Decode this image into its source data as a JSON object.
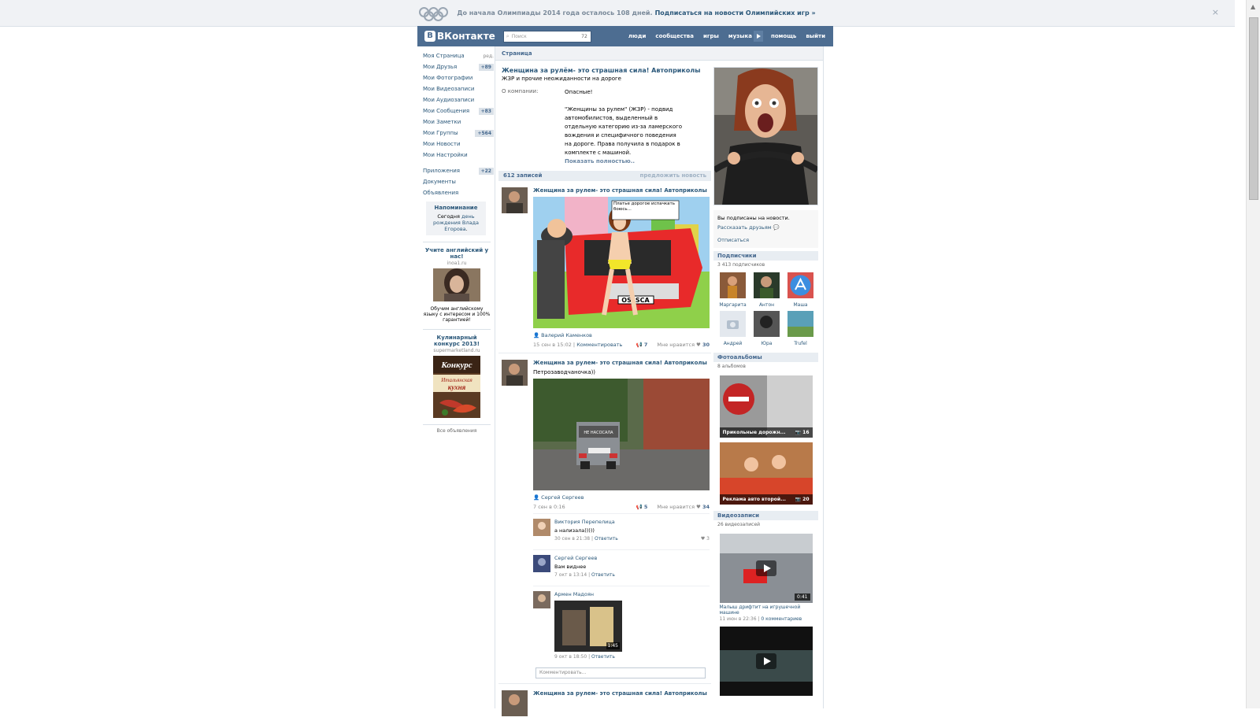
{
  "topbar": {
    "text": "До начала Олимпиады 2014 года осталось 108 дней.",
    "link": "Подписаться на новости Олимпийских игр »",
    "close": "×"
  },
  "header": {
    "logo": "ВКонтакте",
    "logo_letter": "В",
    "search_placeholder": "Поиск",
    "search_count": "72",
    "nav": [
      "люди",
      "сообщества",
      "игры",
      "музыка",
      "помощь",
      "выйти"
    ]
  },
  "leftmenu": {
    "edit": "ред.",
    "items": [
      {
        "label": "Моя Страница",
        "badge": ""
      },
      {
        "label": "Мои Друзья",
        "badge": "+89"
      },
      {
        "label": "Мои Фотографии",
        "badge": ""
      },
      {
        "label": "Мои Видеозаписи",
        "badge": ""
      },
      {
        "label": "Мои Аудиозаписи",
        "badge": ""
      },
      {
        "label": "Мои Сообщения",
        "badge": "+83"
      },
      {
        "label": "Мои Заметки",
        "badge": ""
      },
      {
        "label": "Мои Группы",
        "badge": "+564"
      },
      {
        "label": "Мои Новости",
        "badge": ""
      },
      {
        "label": "Мои Настройки",
        "badge": ""
      }
    ],
    "extra": [
      {
        "label": "Приложения",
        "badge": "+22"
      },
      {
        "label": "Документы",
        "badge": ""
      },
      {
        "label": "Объявления",
        "badge": ""
      }
    ],
    "reminder": {
      "title": "Напоминание",
      "text1": "Сегодня ",
      "link": "день рождения Влада Егорова",
      "text2": "."
    },
    "ads": [
      {
        "title": "Учите английский у нас!",
        "domain": "inoa1.ru",
        "text": "Обучим английскому языку с интересом и 100% гарантией!"
      },
      {
        "title": "Кулинарный конкурс 2013!",
        "domain": "supermarketland.ru",
        "img1": "Конкурс",
        "img2": "Итальянская",
        "img3": "кухня"
      }
    ],
    "all_ads": "Все объявления"
  },
  "page": {
    "breadcrumb": "Страница",
    "title": "Женщина за рулём- это страшная сила! Автоприколы",
    "status": "ЖЗР и прочие неожиданности на дороге",
    "about_label": "О компании:",
    "about_p1": "Опасные!",
    "about_p2": "\"Женщины за рулем\" (ЖЗР) - подвид автомобилистов, выделенный в отдельную категорию из-за ламерского вождения и специфичного поведения на дороге. Права получила в подарок в комплекте с машиной.",
    "show_full": "Показать полностью..",
    "posts_count": "612 записей",
    "suggest": "предложить новость"
  },
  "posts": [
    {
      "author": "Женщина за рулем- это страшная сила! Автоприколы",
      "bubble": "Платье дорогое испачкать боюсь...",
      "plate": "OSSSCA",
      "signer": "Валерий Каменков",
      "date": "15 сен в 15:02",
      "comment": "Комментировать",
      "shares": "7",
      "like": "Мне нравится",
      "likes": "30"
    },
    {
      "author": "Женщина за рулем- это страшная сила! Автоприколы",
      "text": "Петрозаводчаночка))",
      "car_text": "НЕ НАСОСАЛА",
      "signer": "Сергей Сергеев",
      "date": "7 сен в 0:16",
      "shares": "5",
      "like": "Мне нравится",
      "likes": "34",
      "comments": [
        {
          "name": "Виктория Перепелица",
          "text": "а нализала)))))",
          "date": "30 сен в 21:38",
          "reply": "Ответить",
          "likes": "3"
        },
        {
          "name": "Сергей Сергеев",
          "text": "Вам виднее",
          "date": "7 окт в 13:14",
          "reply": "Ответить",
          "likes": ""
        },
        {
          "name": "Армен Мадоян",
          "text": "",
          "date": "9 окт в 18:50",
          "reply": "Ответить",
          "likes": "",
          "video_dur": "1:45"
        }
      ],
      "comment_placeholder": "Комментировать..."
    },
    {
      "author": "Женщина за рулем- это страшная сила! Автоприколы"
    }
  ],
  "side": {
    "subscribed": "Вы подписаны на новости.",
    "tell": "Рассказать друзьям",
    "unsub": "Отписаться",
    "subs_head": "Подписчики",
    "subs_count": "3 413 подписчиков",
    "subs": [
      "Маргарита",
      "Антон",
      "Маша",
      "Андрей",
      "Юра",
      "Trufel"
    ],
    "albums_head": "Фотоальбомы",
    "albums_count": "8 альбомов",
    "albums": [
      {
        "name": "Прикольные дорожн...",
        "count": "16"
      },
      {
        "name": "Реклама авто второй...",
        "count": "20"
      }
    ],
    "videos_head": "Видеозаписи",
    "videos_count": "26 видеозаписей",
    "videos": [
      {
        "duration": "0:41",
        "title": "Малыш дрифтит на игрушечной машине",
        "date": "11 июн в 22:36",
        "comments": "0 комментариев"
      },
      {
        "duration": "",
        "title": "",
        "date": "",
        "comments": ""
      }
    ]
  }
}
